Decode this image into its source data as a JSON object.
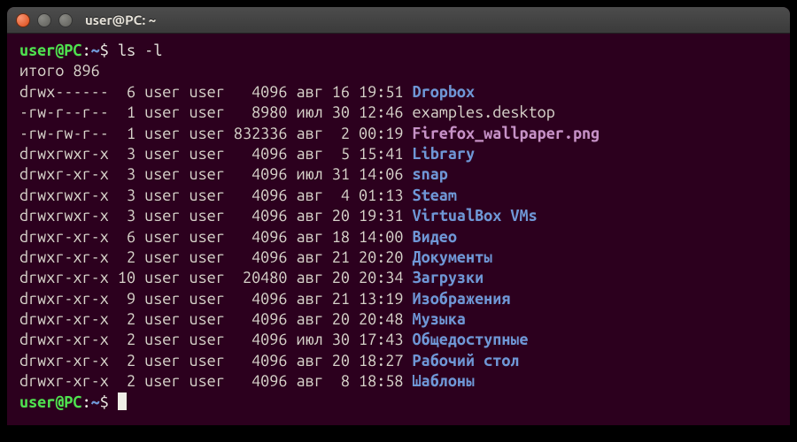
{
  "titlebar": {
    "title": "user@PC: ~"
  },
  "prompt": {
    "userhost": "user@PC",
    "colon": ":",
    "path": "~",
    "sigil": "$"
  },
  "command": "ls -l",
  "total_line": "итого 896",
  "entries": [
    {
      "perm": "drwx------",
      "links": "6",
      "owner": "user",
      "group": "user",
      "size": "4096",
      "month": "авг",
      "day": "16",
      "time": "19:51",
      "name": "Dropbox",
      "kind": "dir"
    },
    {
      "perm": "-rw-r--r--",
      "links": "1",
      "owner": "user",
      "group": "user",
      "size": "8980",
      "month": "июл",
      "day": "30",
      "time": "12:46",
      "name": "examples.desktop",
      "kind": "file"
    },
    {
      "perm": "-rw-rw-r--",
      "links": "1",
      "owner": "user",
      "group": "user",
      "size": "832336",
      "month": "авг",
      "day": "2",
      "time": "00:19",
      "name": "Firefox_wallpaper.png",
      "kind": "img"
    },
    {
      "perm": "drwxrwxr-x",
      "links": "3",
      "owner": "user",
      "group": "user",
      "size": "4096",
      "month": "авг",
      "day": "5",
      "time": "15:41",
      "name": "Library",
      "kind": "dir"
    },
    {
      "perm": "drwxr-xr-x",
      "links": "3",
      "owner": "user",
      "group": "user",
      "size": "4096",
      "month": "июл",
      "day": "31",
      "time": "14:06",
      "name": "snap",
      "kind": "dir"
    },
    {
      "perm": "drwxrwxr-x",
      "links": "3",
      "owner": "user",
      "group": "user",
      "size": "4096",
      "month": "авг",
      "day": "4",
      "time": "01:13",
      "name": "Steam",
      "kind": "dir"
    },
    {
      "perm": "drwxrwxr-x",
      "links": "3",
      "owner": "user",
      "group": "user",
      "size": "4096",
      "month": "авг",
      "day": "20",
      "time": "19:31",
      "name": "VirtualBox VMs",
      "kind": "dir"
    },
    {
      "perm": "drwxr-xr-x",
      "links": "6",
      "owner": "user",
      "group": "user",
      "size": "4096",
      "month": "авг",
      "day": "18",
      "time": "14:00",
      "name": "Видео",
      "kind": "dir"
    },
    {
      "perm": "drwxr-xr-x",
      "links": "2",
      "owner": "user",
      "group": "user",
      "size": "4096",
      "month": "авг",
      "day": "21",
      "time": "20:20",
      "name": "Документы",
      "kind": "dir"
    },
    {
      "perm": "drwxr-xr-x",
      "links": "10",
      "owner": "user",
      "group": "user",
      "size": "20480",
      "month": "авг",
      "day": "20",
      "time": "20:34",
      "name": "Загрузки",
      "kind": "dir"
    },
    {
      "perm": "drwxr-xr-x",
      "links": "9",
      "owner": "user",
      "group": "user",
      "size": "4096",
      "month": "авг",
      "day": "21",
      "time": "13:19",
      "name": "Изображения",
      "kind": "dir"
    },
    {
      "perm": "drwxr-xr-x",
      "links": "2",
      "owner": "user",
      "group": "user",
      "size": "4096",
      "month": "авг",
      "day": "20",
      "time": "20:48",
      "name": "Музыка",
      "kind": "dir"
    },
    {
      "perm": "drwxr-xr-x",
      "links": "2",
      "owner": "user",
      "group": "user",
      "size": "4096",
      "month": "июл",
      "day": "30",
      "time": "17:43",
      "name": "Общедоступные",
      "kind": "dir"
    },
    {
      "perm": "drwxr-xr-x",
      "links": "2",
      "owner": "user",
      "group": "user",
      "size": "4096",
      "month": "авг",
      "day": "20",
      "time": "18:27",
      "name": "Рабочий стол",
      "kind": "dir"
    },
    {
      "perm": "drwxr-xr-x",
      "links": "2",
      "owner": "user",
      "group": "user",
      "size": "4096",
      "month": "авг",
      "day": "8",
      "time": "18:58",
      "name": "Шаблоны",
      "kind": "dir"
    }
  ]
}
